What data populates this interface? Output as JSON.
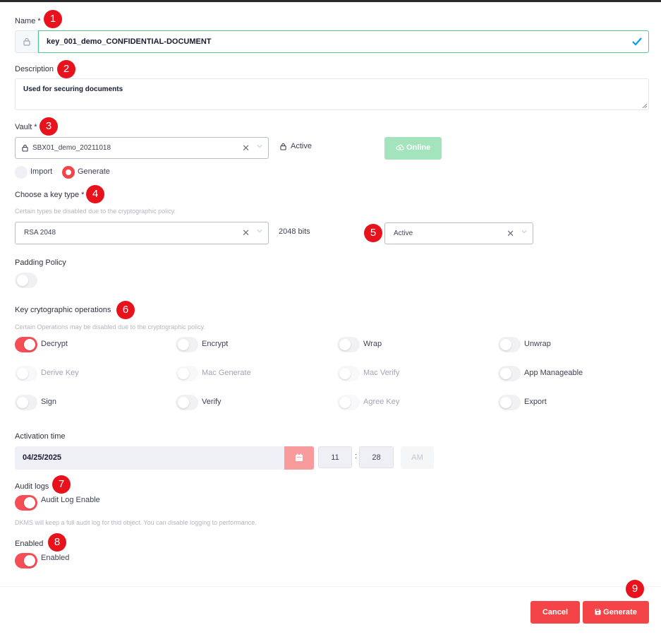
{
  "name": {
    "label": "Name *",
    "value": "key_001_demo_CONFIDENTIAL-DOCUMENT"
  },
  "description": {
    "label": "Description",
    "value": "Used for securing documents"
  },
  "vault": {
    "label": "Vault *",
    "value": "SBX01_demo_20211018",
    "status": "Active",
    "online_label": "Online"
  },
  "mode": {
    "import_label": "Import",
    "generate_label": "Generate",
    "selected": "Generate"
  },
  "key_type": {
    "label": "Choose a key type *",
    "hint": "Certain types be disabled due to the cryptographic policy.",
    "value": "RSA 2048",
    "bits": "2048 bits",
    "state": "Active"
  },
  "padding": {
    "label": "Padding Policy",
    "enabled": false
  },
  "operations": {
    "label": "Key crytographic operations",
    "hint": "Certain Operations may be disabled due to the cryptographic policy.",
    "items": [
      {
        "label": "Decrypt",
        "on": true,
        "disabled": false
      },
      {
        "label": "Encrypt",
        "on": false,
        "disabled": false
      },
      {
        "label": "Wrap",
        "on": false,
        "disabled": false
      },
      {
        "label": "Unwrap",
        "on": false,
        "disabled": false
      },
      {
        "label": "Derive Key",
        "on": false,
        "disabled": true
      },
      {
        "label": "Mac Generate",
        "on": false,
        "disabled": true
      },
      {
        "label": "Mac Verify",
        "on": false,
        "disabled": true
      },
      {
        "label": "App Manageable",
        "on": false,
        "disabled": false
      },
      {
        "label": "Sign",
        "on": false,
        "disabled": false
      },
      {
        "label": "Verify",
        "on": false,
        "disabled": false
      },
      {
        "label": "Agree Key",
        "on": false,
        "disabled": true
      },
      {
        "label": "Export",
        "on": false,
        "disabled": false
      }
    ]
  },
  "activation": {
    "label": "Activation time",
    "date": "04/25/2025",
    "hour": "11",
    "sep": ":",
    "minute": "28",
    "ampm": "AM"
  },
  "audit": {
    "label": "Audit logs",
    "toggle_label": "Audit Log Enable",
    "on": true,
    "hint": "DKMS will keep a full audit log for thid object. You can disable logging to performance."
  },
  "enabled": {
    "label": "Enabled",
    "toggle_label": "Enabled",
    "on": true
  },
  "footer": {
    "cancel_label": "Cancel",
    "generate_label": "Generate"
  },
  "badges": [
    "1",
    "2",
    "3",
    "4",
    "5",
    "6",
    "7",
    "8",
    "9"
  ],
  "colors": {
    "accent": "#f54447",
    "valid": "#50cd89",
    "badge": "#e8121c",
    "online_bg": "#a3e4bc"
  }
}
